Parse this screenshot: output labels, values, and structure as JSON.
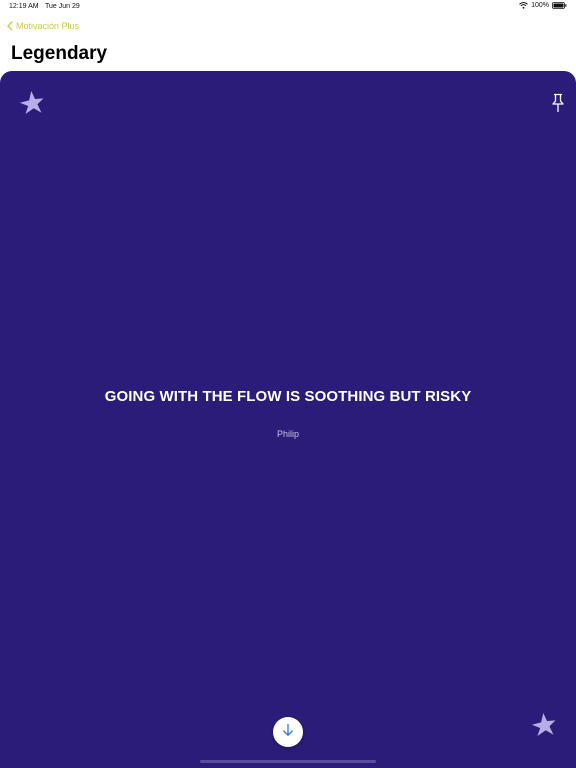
{
  "status_bar": {
    "time": "12:19 AM",
    "date": "Tue Jun 29",
    "battery": "100%"
  },
  "nav": {
    "back_label": "Motivación Plus",
    "title": "Legendary"
  },
  "quote": {
    "text": "GOING WITH THE FLOW IS SOOTHING BUT RISKY",
    "author": "Philip"
  },
  "colors": {
    "card_background": "#2a1c78",
    "back_accent": "#c9c94b",
    "star_fill": "#b6aee6",
    "down_arrow": "#3b7de0"
  },
  "icons": {
    "top_left": "star-icon",
    "top_right": "pin-icon",
    "bottom_right": "star-icon",
    "bottom_center": "arrow-down-icon",
    "back": "chevron-left-icon"
  }
}
